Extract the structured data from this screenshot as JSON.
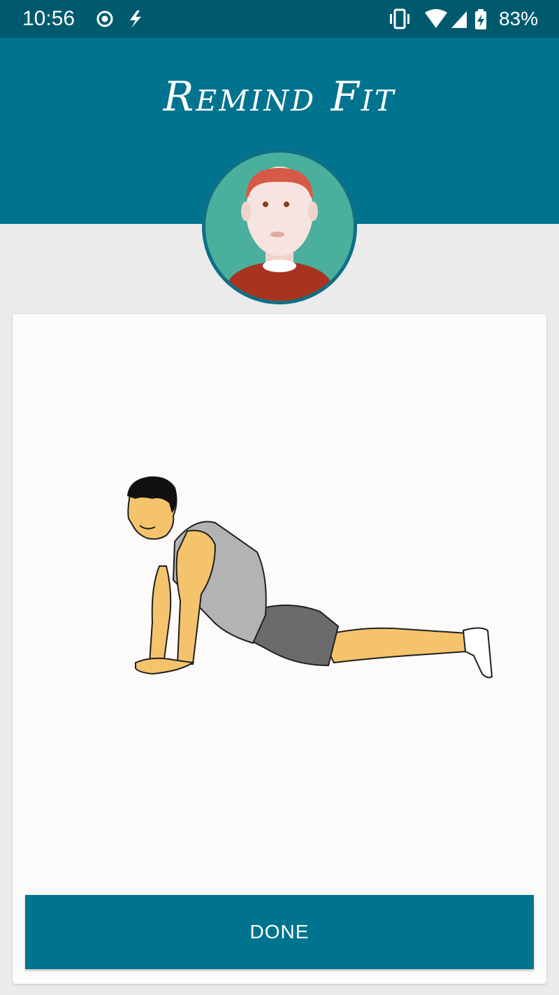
{
  "status_bar": {
    "time": "10:56",
    "left_icons": [
      "record-icon",
      "flash-icon"
    ],
    "right_icons": [
      "vibrate-icon",
      "wifi-icon",
      "cell-signal-icon",
      "battery-charging-icon"
    ],
    "battery_percent": "83%"
  },
  "header": {
    "title": "Remind Fit",
    "background_color": "#00748f"
  },
  "avatar": {
    "icon": "user-avatar-icon"
  },
  "exercise": {
    "illustration": "push-up-illustration"
  },
  "actions": {
    "done_label": "DONE"
  },
  "colors": {
    "status_bar": "#005a6e",
    "accent": "#00748f",
    "page_background": "#ebebeb",
    "card": "#fdfbfa"
  }
}
